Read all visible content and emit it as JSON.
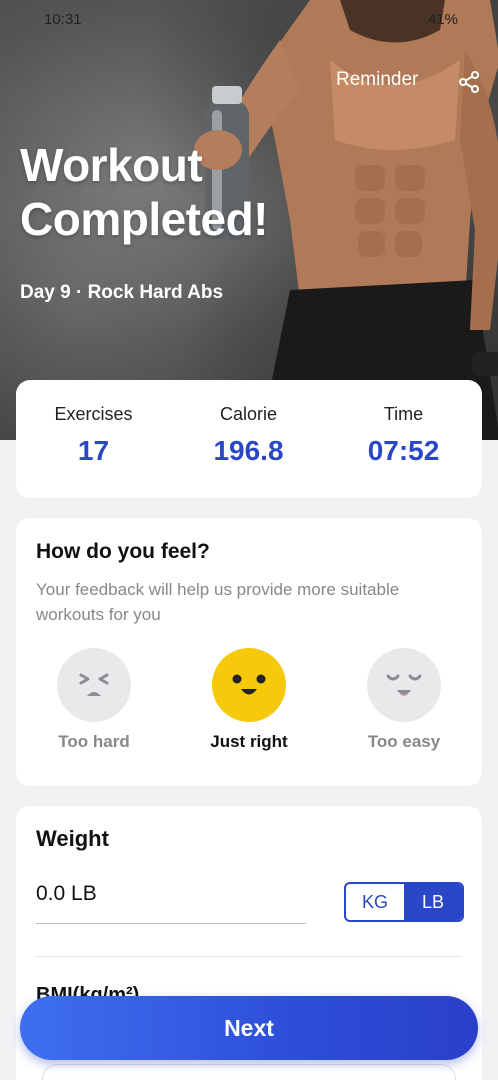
{
  "status_bar": {
    "time": "10:31",
    "battery": "41%"
  },
  "header": {
    "reminder_label": "Reminder",
    "title_line1": "Workout",
    "title_line2": "Completed!",
    "subtitle": "Day 9 · Rock Hard Abs"
  },
  "stats": [
    {
      "label": "Exercises",
      "value": "17"
    },
    {
      "label": "Calorie",
      "value": "196.8"
    },
    {
      "label": "Time",
      "value": "07:52"
    }
  ],
  "feedback": {
    "title": "How do you feel?",
    "description": "Your feedback will help us provide more suitable workouts for you",
    "options": [
      {
        "label": "Too hard",
        "selected": false
      },
      {
        "label": "Just right",
        "selected": true
      },
      {
        "label": "Too easy",
        "selected": false
      }
    ]
  },
  "weight": {
    "title": "Weight",
    "value": "0.0 LB",
    "units": [
      "KG",
      "LB"
    ],
    "selected_unit": "LB",
    "bmi_label": "BMI(kg/m²)"
  },
  "next_label": "Next",
  "colors": {
    "accent": "#2a47c7",
    "selected_face": "#f7c90b",
    "unselected_face": "#e9e9ec"
  }
}
